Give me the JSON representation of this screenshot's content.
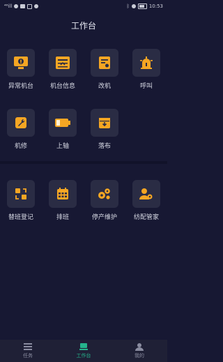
{
  "status_bar": {
    "left_text": "⁴⁶ill",
    "time": "10:53",
    "battery_text": ""
  },
  "header": {
    "title": "工作台"
  },
  "section1": [
    {
      "label": "异常机台",
      "icon": "alert-monitor-icon"
    },
    {
      "label": "机台信息",
      "icon": "machine-info-icon"
    },
    {
      "label": "改机",
      "icon": "modify-icon"
    },
    {
      "label": "呼叫",
      "icon": "siren-icon"
    },
    {
      "label": "机修",
      "icon": "wrench-icon"
    },
    {
      "label": "上轴",
      "icon": "battery-axis-icon"
    },
    {
      "label": "落布",
      "icon": "inbox-icon"
    }
  ],
  "section2": [
    {
      "label": "替班登记",
      "icon": "swap-icon"
    },
    {
      "label": "排班",
      "icon": "calendar-icon"
    },
    {
      "label": "停产维护",
      "icon": "gears-icon"
    },
    {
      "label": "纺配管家",
      "icon": "user-gear-icon"
    }
  ],
  "bottom_nav": [
    {
      "label": "任务",
      "icon": "list-icon"
    },
    {
      "label": "工作台",
      "icon": "workbench-icon",
      "active": true
    },
    {
      "label": "我的",
      "icon": "profile-icon"
    }
  ],
  "colors": {
    "accent": "#f5a623",
    "active_nav": "#25b48c",
    "background": "#171833",
    "tile_bg": "#2a2c44"
  }
}
